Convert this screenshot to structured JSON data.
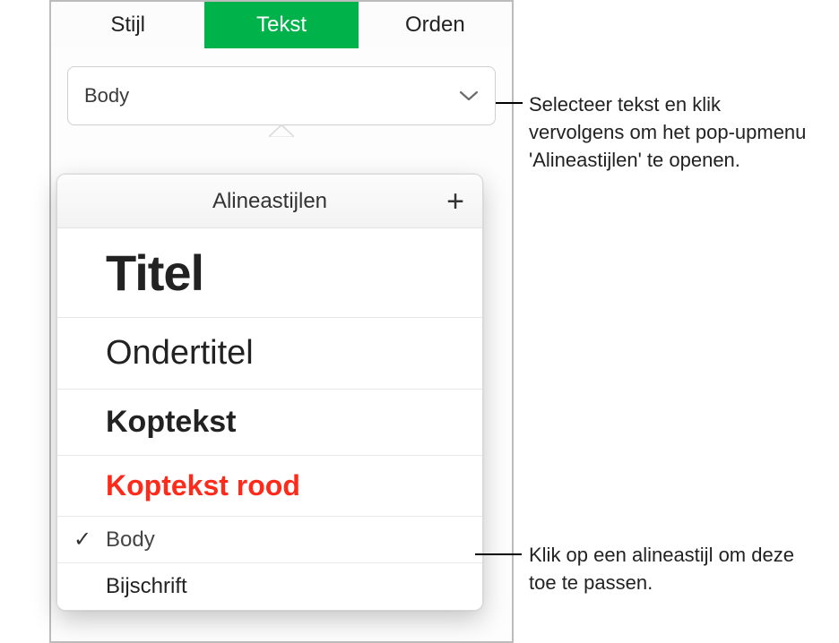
{
  "tabs": {
    "style": "Stijl",
    "text": "Tekst",
    "order": "Orden"
  },
  "selector": {
    "current": "Body"
  },
  "popup": {
    "title": "Alineastijlen",
    "add_label": "+"
  },
  "styles": {
    "titel": "Titel",
    "ondertitel": "Ondertitel",
    "koptekst": "Koptekst",
    "koptekst_rood": "Koptekst rood",
    "body": "Body",
    "bijschrift": "Bijschrift",
    "checkmark": "✓"
  },
  "callouts": {
    "c1": "Selecteer tekst en klik vervolgens om het pop-upmenu 'Alineastijlen' te openen.",
    "c2": "Klik op een alineastijl om deze toe te passen."
  }
}
